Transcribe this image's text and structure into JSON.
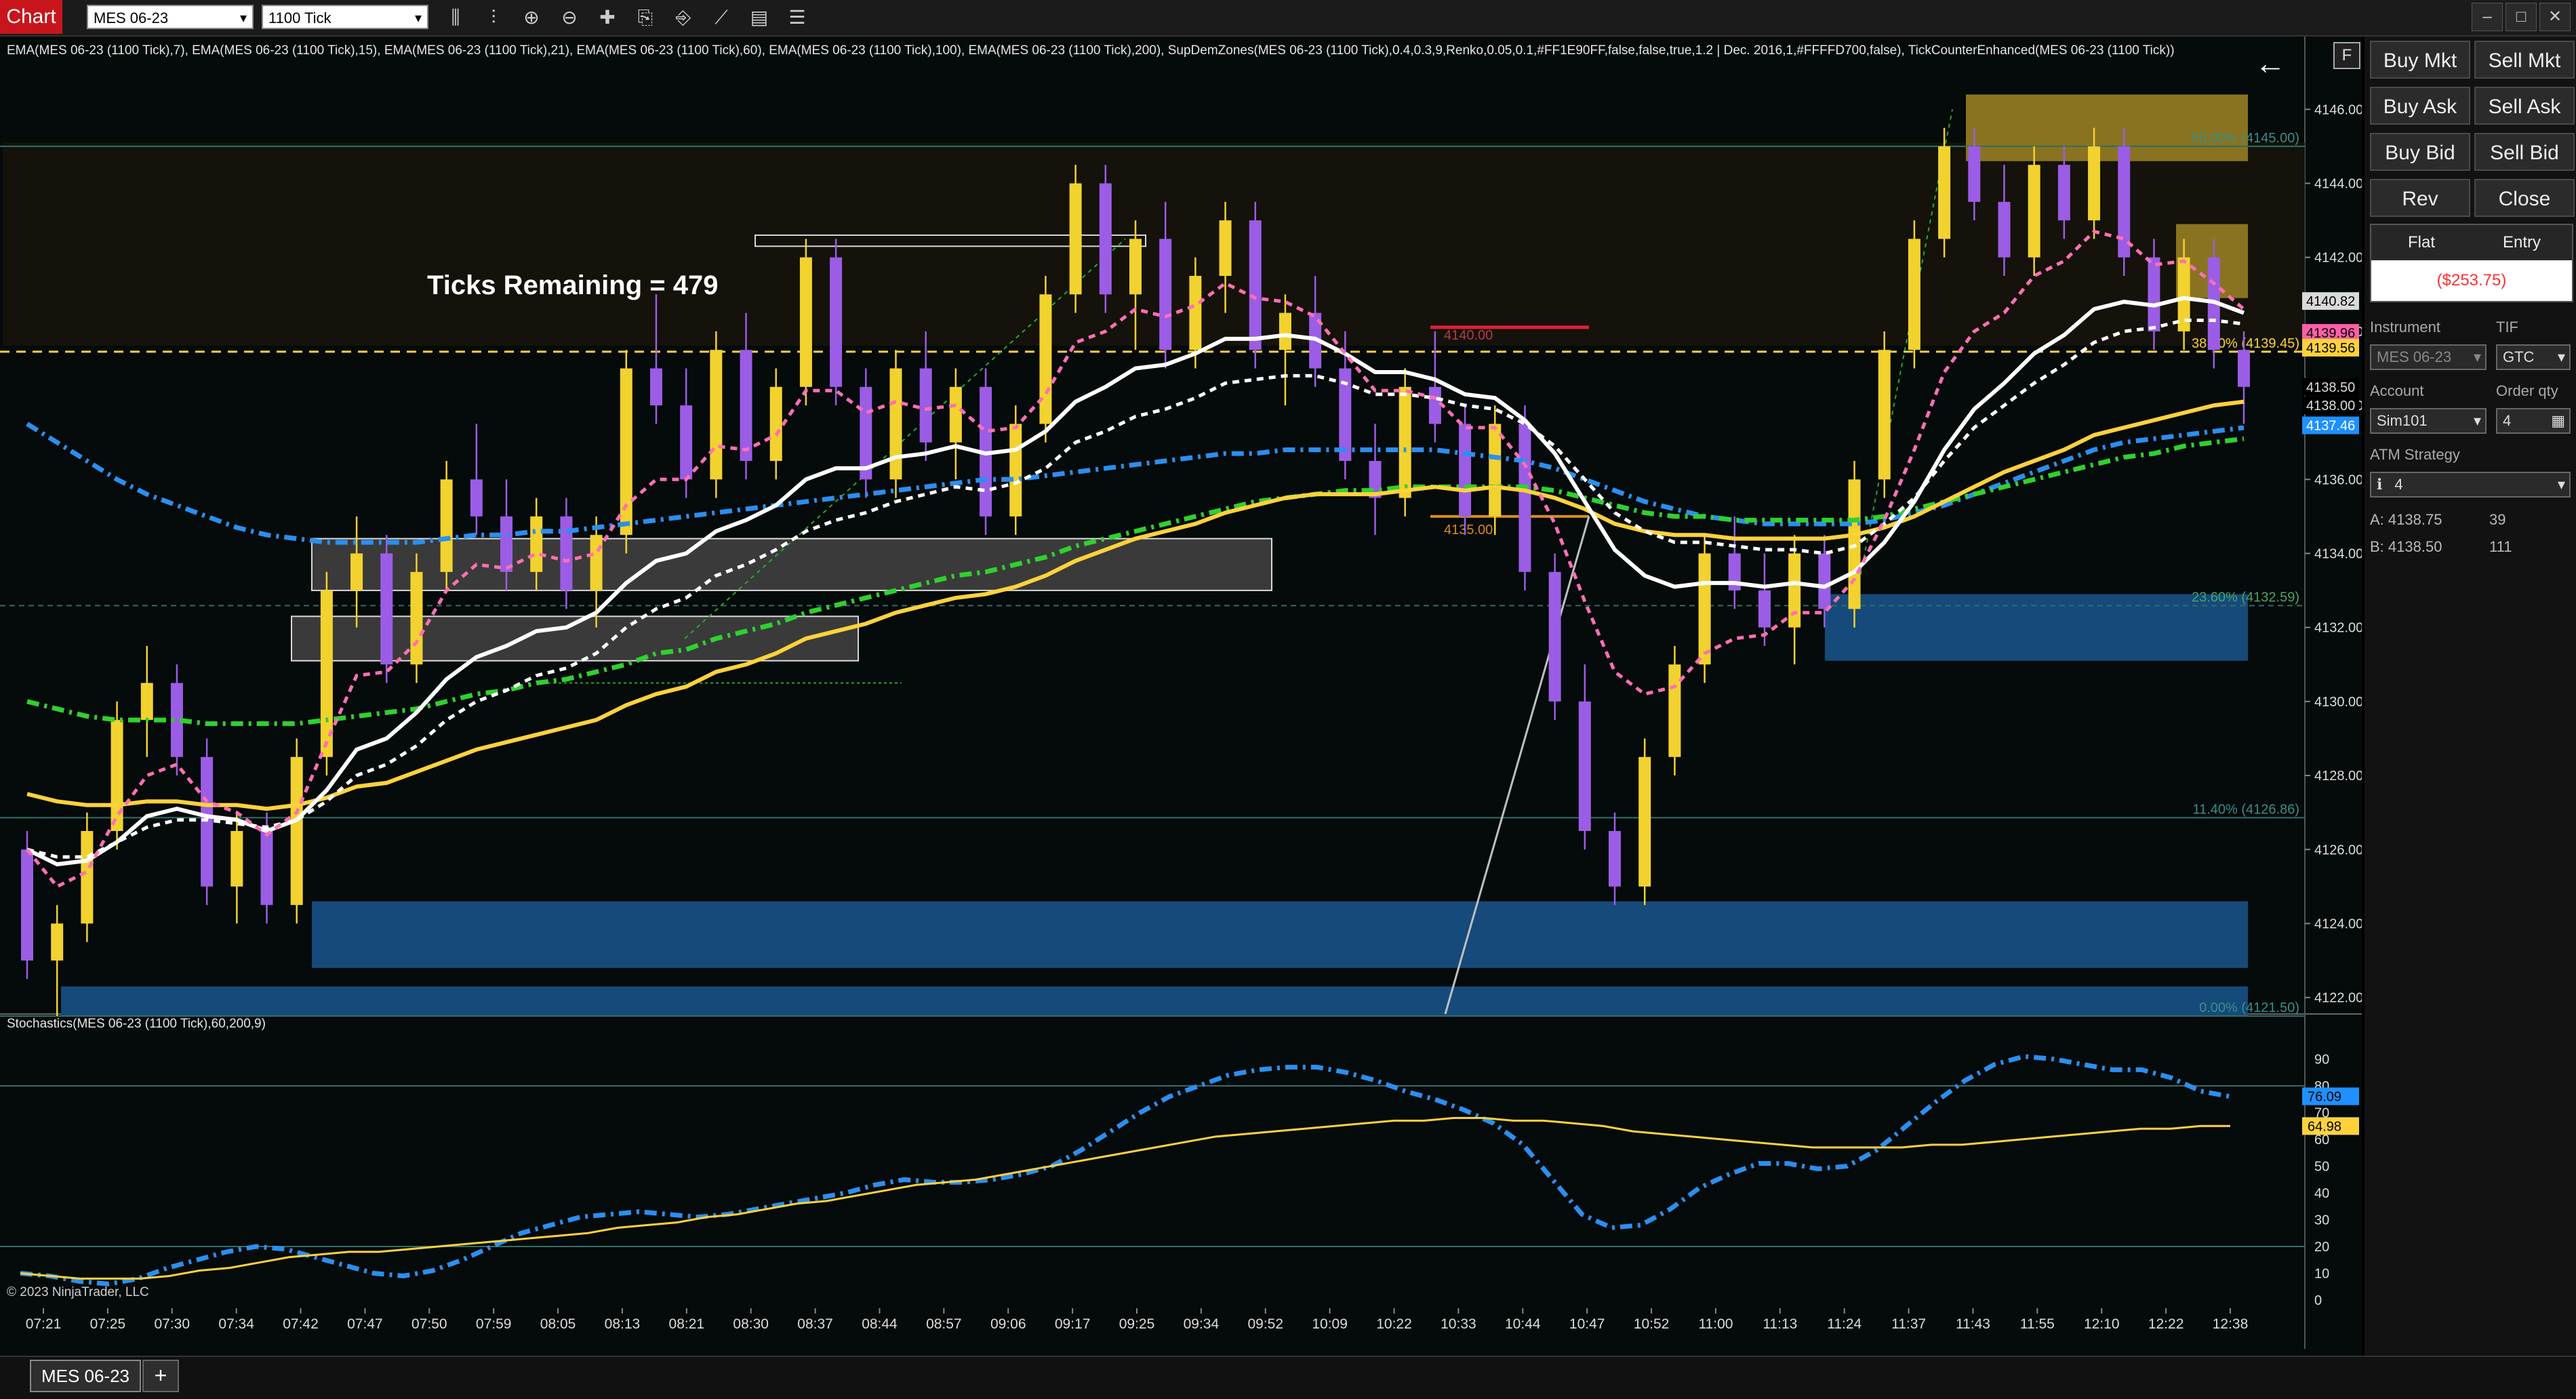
{
  "titlebar": {
    "chart_label": "Chart",
    "instrument": "MES 06-23",
    "interval": "1100 Tick",
    "tool_icons": [
      "bar-type-icon",
      "indicators-icon",
      "zoom-in-icon",
      "zoom-out-icon",
      "crosshair-icon",
      "properties-icon",
      "strategies-icon",
      "drawing-tools-icon",
      "data-box-icon",
      "list-icon"
    ]
  },
  "indicator_header": "EMA(MES 06-23 (1100 Tick),7), EMA(MES 06-23 (1100 Tick),15), EMA(MES 06-23 (1100 Tick),21), EMA(MES 06-23 (1100 Tick),60), EMA(MES 06-23 (1100 Tick),100), EMA(MES 06-23 (1100 Tick),200), SupDemZones(MES 06-23 (1100 Tick),0.4,0.3,9,Renko,0.05,0.1,#FF1E90FF,false,false,true,1.2 | Dec. 2016,1,#FFFFD700,false), TickCounterEnhanced(MES 06-23 (1100 Tick))",
  "ticks_remaining": "Ticks Remaining = 479",
  "fib_labels": [
    "50.00% (4145.00)",
    "38.20% (4139.45)",
    "23.60% (4132.59)",
    "11.40% (4126.86)",
    "0.00% (4121.50)"
  ],
  "drawn_labels": [
    "4140.00",
    "4135.00"
  ],
  "price_axis": [
    "4146.00",
    "4144.00",
    "4142.00",
    "4140.00",
    "4138.00",
    "4136.00",
    "4134.00",
    "4132.00",
    "4130.00",
    "4128.00",
    "4126.00",
    "4124.00",
    "4122.00"
  ],
  "price_tags": [
    {
      "text": "4140.82",
      "color": "#d9d9d9",
      "fg": "#000"
    },
    {
      "text": "4139.96",
      "color": "#ff5fa8",
      "fg": "#000"
    },
    {
      "text": "4139.56",
      "color": "#ffd23c",
      "fg": "#000"
    },
    {
      "text": "4138.50",
      "color": "#000",
      "fg": "#ddd"
    },
    {
      "text": "4138.00",
      "color": "#000",
      "fg": "#ddd"
    },
    {
      "text": "4137.46",
      "color": "#1e90ff",
      "fg": "#fff"
    }
  ],
  "stoch_header": "Stochastics(MES 06-23 (1100 Tick),60,200,9)",
  "stoch_axis": [
    "90",
    "80",
    "70",
    "60",
    "50",
    "40",
    "30",
    "20",
    "10",
    "0"
  ],
  "stoch_tags": [
    {
      "text": "76.09",
      "color": "#1e90ff"
    },
    {
      "text": "64.98",
      "color": "#ffd23c"
    }
  ],
  "time_axis": [
    "07:21",
    "07:25",
    "07:30",
    "07:34",
    "07:42",
    "07:47",
    "07:50",
    "07:59",
    "08:05",
    "08:13",
    "08:21",
    "08:30",
    "08:37",
    "08:44",
    "08:57",
    "09:06",
    "09:17",
    "09:25",
    "09:34",
    "09:52",
    "10:09",
    "10:22",
    "10:33",
    "10:44",
    "10:47",
    "10:52",
    "11:00",
    "11:13",
    "11:24",
    "11:37",
    "11:43",
    "11:55",
    "12:10",
    "12:22",
    "12:38"
  ],
  "copyright": "© 2023 NinjaTrader, LLC",
  "chart_data": {
    "type": "candlestick",
    "price_range": [
      4121.5,
      4146.5
    ],
    "last_price": 4138.5,
    "candles_ohlc": [
      [
        4126.0,
        4126.5,
        4122.5,
        4123.0
      ],
      [
        4123.0,
        4124.5,
        4121.5,
        4124.0
      ],
      [
        4124.0,
        4127.0,
        4123.5,
        4126.5
      ],
      [
        4126.5,
        4130.0,
        4126.0,
        4129.5
      ],
      [
        4129.5,
        4131.5,
        4128.5,
        4130.5
      ],
      [
        4130.5,
        4131.0,
        4128.0,
        4128.5
      ],
      [
        4128.5,
        4129.0,
        4124.5,
        4125.0
      ],
      [
        4125.0,
        4127.0,
        4124.0,
        4126.5
      ],
      [
        4126.5,
        4127.0,
        4124.0,
        4124.5
      ],
      [
        4124.5,
        4129.0,
        4124.0,
        4128.5
      ],
      [
        4128.5,
        4133.5,
        4128.0,
        4133.0
      ],
      [
        4133.0,
        4135.0,
        4132.0,
        4134.0
      ],
      [
        4134.0,
        4134.5,
        4130.5,
        4131.0
      ],
      [
        4131.0,
        4134.0,
        4130.5,
        4133.5
      ],
      [
        4133.5,
        4136.5,
        4133.0,
        4136.0
      ],
      [
        4136.0,
        4137.5,
        4134.5,
        4135.0
      ],
      [
        4135.0,
        4136.0,
        4133.0,
        4133.5
      ],
      [
        4133.5,
        4135.5,
        4133.0,
        4135.0
      ],
      [
        4135.0,
        4135.5,
        4132.5,
        4133.0
      ],
      [
        4133.0,
        4135.0,
        4132.0,
        4134.5
      ],
      [
        4134.5,
        4139.5,
        4134.0,
        4139.0
      ],
      [
        4139.0,
        4141.0,
        4137.5,
        4138.0
      ],
      [
        4138.0,
        4139.0,
        4135.5,
        4136.0
      ],
      [
        4136.0,
        4140.0,
        4135.5,
        4139.5
      ],
      [
        4139.5,
        4140.5,
        4136.0,
        4136.5
      ],
      [
        4136.5,
        4139.0,
        4136.0,
        4138.5
      ],
      [
        4138.5,
        4142.5,
        4138.0,
        4142.0
      ],
      [
        4142.0,
        4142.5,
        4138.0,
        4138.5
      ],
      [
        4138.5,
        4139.0,
        4135.5,
        4136.0
      ],
      [
        4136.0,
        4139.5,
        4135.5,
        4139.0
      ],
      [
        4139.0,
        4140.0,
        4136.5,
        4137.0
      ],
      [
        4137.0,
        4139.0,
        4136.0,
        4138.5
      ],
      [
        4138.5,
        4139.0,
        4134.5,
        4135.0
      ],
      [
        4135.0,
        4138.0,
        4134.5,
        4137.5
      ],
      [
        4137.5,
        4141.5,
        4137.0,
        4141.0
      ],
      [
        4141.0,
        4144.5,
        4140.5,
        4144.0
      ],
      [
        4144.0,
        4144.5,
        4140.5,
        4141.0
      ],
      [
        4141.0,
        4143.0,
        4139.5,
        4142.5
      ],
      [
        4142.5,
        4143.5,
        4139.0,
        4139.5
      ],
      [
        4139.5,
        4142.0,
        4139.0,
        4141.5
      ],
      [
        4141.5,
        4143.5,
        4140.5,
        4143.0
      ],
      [
        4143.0,
        4143.5,
        4139.0,
        4139.5
      ],
      [
        4139.5,
        4141.0,
        4138.0,
        4140.5
      ],
      [
        4140.5,
        4141.5,
        4138.5,
        4139.0
      ],
      [
        4139.0,
        4140.0,
        4136.0,
        4136.5
      ],
      [
        4136.5,
        4137.5,
        4134.5,
        4135.5
      ],
      [
        4135.5,
        4139.0,
        4135.0,
        4138.5
      ],
      [
        4138.5,
        4140.0,
        4137.0,
        4137.5
      ],
      [
        4137.5,
        4138.0,
        4134.5,
        4135.0
      ],
      [
        4135.0,
        4138.0,
        4134.5,
        4137.5
      ],
      [
        4137.5,
        4138.0,
        4133.0,
        4133.5
      ],
      [
        4133.5,
        4134.0,
        4129.5,
        4130.0
      ],
      [
        4130.0,
        4131.0,
        4126.0,
        4126.5
      ],
      [
        4126.5,
        4127.0,
        4124.5,
        4125.0
      ],
      [
        4125.0,
        4129.0,
        4124.5,
        4128.5
      ],
      [
        4128.5,
        4131.5,
        4128.0,
        4131.0
      ],
      [
        4131.0,
        4134.5,
        4130.5,
        4134.0
      ],
      [
        4134.0,
        4135.0,
        4132.5,
        4133.0
      ],
      [
        4133.0,
        4134.0,
        4131.5,
        4132.0
      ],
      [
        4132.0,
        4134.5,
        4131.0,
        4134.0
      ],
      [
        4134.0,
        4134.5,
        4132.0,
        4132.5
      ],
      [
        4132.5,
        4136.5,
        4132.0,
        4136.0
      ],
      [
        4136.0,
        4140.0,
        4135.5,
        4139.5
      ],
      [
        4139.5,
        4143.0,
        4139.0,
        4142.5
      ],
      [
        4142.5,
        4145.5,
        4142.0,
        4145.0
      ],
      [
        4145.0,
        4145.5,
        4143.0,
        4143.5
      ],
      [
        4143.5,
        4144.5,
        4141.5,
        4142.0
      ],
      [
        4142.0,
        4145.0,
        4141.5,
        4144.5
      ],
      [
        4144.5,
        4145.0,
        4142.5,
        4143.0
      ],
      [
        4143.0,
        4145.5,
        4142.5,
        4145.0
      ],
      [
        4145.0,
        4145.5,
        4141.5,
        4142.0
      ],
      [
        4142.0,
        4142.5,
        4139.5,
        4140.0
      ],
      [
        4140.0,
        4142.5,
        4139.5,
        4142.0
      ],
      [
        4142.0,
        4142.5,
        4139.0,
        4139.5
      ],
      [
        4139.5,
        4140.0,
        4137.5,
        4138.5
      ]
    ],
    "ema_7": [
      4126,
      4125,
      4125.4,
      4126.9,
      4128,
      4128.3,
      4127.3,
      4127,
      4126.4,
      4127,
      4128.9,
      4130.7,
      4130.8,
      4131.6,
      4133,
      4133.7,
      4133.6,
      4134,
      4133.8,
      4134,
      4135.3,
      4136,
      4136,
      4136.9,
      4136.8,
      4137.2,
      4138.4,
      4138.4,
      4137.8,
      4138.1,
      4137.9,
      4138,
      4137.3,
      4137.4,
      4138.3,
      4139.7,
      4140,
      4140.6,
      4140.4,
      4140.7,
      4141.3,
      4140.9,
      4140.8,
      4140.4,
      4139.4,
      4138.4,
      4138.4,
      4138.2,
      4137.4,
      4137.4,
      4136.4,
      4134.8,
      4132.7,
      4130.8,
      4130.2,
      4130.4,
      4131.3,
      4131.7,
      4131.8,
      4132.4,
      4132.4,
      4133.3,
      4134.9,
      4136.8,
      4138.9,
      4140,
      4140.5,
      4141.5,
      4141.9,
      4142.7,
      4142.5,
      4141.8,
      4141.9,
      4141.3,
      4140.6
    ],
    "ema_15": [
      4126,
      4125.6,
      4125.7,
      4126.2,
      4126.9,
      4127.1,
      4126.9,
      4126.8,
      4126.5,
      4126.8,
      4127.6,
      4128.7,
      4129,
      4129.7,
      4130.6,
      4131.2,
      4131.5,
      4131.9,
      4132,
      4132.4,
      4133.2,
      4133.8,
      4134,
      4134.6,
      4134.9,
      4135.3,
      4136,
      4136.3,
      4136.3,
      4136.6,
      4136.7,
      4136.9,
      4136.7,
      4136.8,
      4137.3,
      4138.1,
      4138.5,
      4139,
      4139.1,
      4139.4,
      4139.8,
      4139.8,
      4139.9,
      4139.8,
      4139.4,
      4138.9,
      4138.9,
      4138.7,
      4138.3,
      4138.2,
      4137.6,
      4136.7,
      4135.4,
      4134.1,
      4133.4,
      4133.1,
      4133.2,
      4133.2,
      4133.1,
      4133.2,
      4133.1,
      4133.5,
      4134.3,
      4135.4,
      4136.8,
      4137.9,
      4138.6,
      4139.4,
      4139.9,
      4140.6,
      4140.8,
      4140.7,
      4140.9,
      4140.8,
      4140.5
    ],
    "ema_21": [
      4126,
      4125.8,
      4125.8,
      4126.2,
      4126.6,
      4126.8,
      4126.8,
      4126.7,
      4126.6,
      4126.8,
      4127.3,
      4128,
      4128.3,
      4128.8,
      4129.5,
      4130,
      4130.3,
      4130.7,
      4130.9,
      4131.3,
      4132,
      4132.5,
      4132.8,
      4133.4,
      4133.7,
      4134.1,
      4134.6,
      4134.9,
      4135.1,
      4135.4,
      4135.6,
      4135.8,
      4135.7,
      4135.9,
      4136.3,
      4137,
      4137.3,
      4137.7,
      4137.9,
      4138.2,
      4138.6,
      4138.7,
      4138.8,
      4138.8,
      4138.6,
      4138.3,
      4138.3,
      4138.2,
      4138,
      4137.9,
      4137.5,
      4136.9,
      4136,
      4135.1,
      4134.6,
      4134.3,
      4134.3,
      4134.2,
      4134.1,
      4134.1,
      4134,
      4134.2,
      4134.8,
      4135.5,
      4136.5,
      4137.4,
      4138,
      4138.6,
      4139.1,
      4139.7,
      4140,
      4140.1,
      4140.3,
      4140.3,
      4140.2
    ],
    "ema_60": [
      4127.5,
      4127.3,
      4127.2,
      4127.2,
      4127.3,
      4127.3,
      4127.2,
      4127.2,
      4127.1,
      4127.2,
      4127.4,
      4127.7,
      4127.8,
      4128.1,
      4128.4,
      4128.7,
      4128.9,
      4129.1,
      4129.3,
      4129.5,
      4129.9,
      4130.2,
      4130.4,
      4130.8,
      4131,
      4131.3,
      4131.7,
      4131.9,
      4132.1,
      4132.4,
      4132.6,
      4132.8,
      4132.9,
      4133.1,
      4133.4,
      4133.8,
      4134.1,
      4134.4,
      4134.6,
      4134.8,
      4135.1,
      4135.3,
      4135.5,
      4135.6,
      4135.6,
      4135.6,
      4135.7,
      4135.8,
      4135.7,
      4135.8,
      4135.7,
      4135.5,
      4135.2,
      4134.8,
      4134.6,
      4134.5,
      4134.5,
      4134.4,
      4134.4,
      4134.4,
      4134.4,
      4134.5,
      4134.7,
      4135,
      4135.4,
      4135.8,
      4136.2,
      4136.5,
      4136.8,
      4137.2,
      4137.4,
      4137.6,
      4137.8,
      4138,
      4138.1
    ],
    "ema_100": [
      4130,
      4129.8,
      4129.6,
      4129.5,
      4129.5,
      4129.5,
      4129.4,
      4129.4,
      4129.4,
      4129.4,
      4129.5,
      4129.6,
      4129.7,
      4129.8,
      4130,
      4130.2,
      4130.3,
      4130.5,
      4130.6,
      4130.8,
      4131,
      4131.3,
      4131.4,
      4131.7,
      4131.9,
      4132.1,
      4132.4,
      4132.6,
      4132.8,
      4133,
      4133.2,
      4133.4,
      4133.5,
      4133.7,
      4133.9,
      4134.2,
      4134.4,
      4134.6,
      4134.8,
      4135,
      4135.2,
      4135.4,
      4135.5,
      4135.6,
      4135.7,
      4135.7,
      4135.8,
      4135.8,
      4135.8,
      4135.8,
      4135.8,
      4135.7,
      4135.5,
      4135.3,
      4135.1,
      4135,
      4135,
      4134.9,
      4134.9,
      4134.9,
      4134.9,
      4134.9,
      4135,
      4135.2,
      4135.4,
      4135.6,
      4135.8,
      4136,
      4136.2,
      4136.4,
      4136.6,
      4136.7,
      4136.9,
      4137,
      4137.1
    ],
    "ema_200": [
      4137.5,
      4137,
      4136.5,
      4136,
      4135.6,
      4135.3,
      4135,
      4134.7,
      4134.5,
      4134.4,
      4134.3,
      4134.3,
      4134.3,
      4134.3,
      4134.4,
      4134.5,
      4134.5,
      4134.6,
      4134.6,
      4134.7,
      4134.8,
      4134.9,
      4135,
      4135.1,
      4135.2,
      4135.3,
      4135.4,
      4135.5,
      4135.6,
      4135.7,
      4135.8,
      4135.9,
      4136,
      4136,
      4136.1,
      4136.2,
      4136.3,
      4136.4,
      4136.5,
      4136.6,
      4136.7,
      4136.7,
      4136.8,
      4136.8,
      4136.8,
      4136.8,
      4136.8,
      4136.8,
      4136.7,
      4136.6,
      4136.5,
      4136.3,
      4136,
      4135.7,
      4135.4,
      4135.2,
      4135,
      4134.9,
      4134.8,
      4134.8,
      4134.8,
      4134.8,
      4134.9,
      4135.1,
      4135.3,
      4135.6,
      4135.9,
      4136.2,
      4136.5,
      4136.8,
      4137,
      4137.1,
      4137.2,
      4137.3,
      4137.4
    ],
    "stoch_k": [
      10,
      9,
      7,
      6,
      8,
      12,
      15,
      18,
      20,
      19,
      16,
      13,
      10,
      9,
      11,
      15,
      20,
      25,
      28,
      31,
      32,
      33,
      32,
      31,
      32,
      34,
      36,
      38,
      40,
      43,
      45,
      44,
      44,
      45,
      47,
      50,
      56,
      63,
      70,
      76,
      80,
      84,
      86,
      87,
      87,
      85,
      82,
      78,
      75,
      71,
      66,
      58,
      45,
      32,
      27,
      28,
      34,
      42,
      47,
      51,
      51,
      49,
      50,
      56,
      65,
      74,
      82,
      88,
      91,
      90,
      88,
      86,
      86,
      83,
      78,
      76
    ],
    "stoch_d": [
      10,
      9,
      8,
      8,
      8,
      9,
      11,
      12,
      14,
      16,
      17,
      18,
      18,
      19,
      20,
      21,
      22,
      23,
      24,
      25,
      27,
      28,
      29,
      31,
      32,
      34,
      36,
      37,
      39,
      41,
      43,
      44,
      45,
      47,
      49,
      51,
      53,
      55,
      57,
      59,
      61,
      62,
      63,
      64,
      65,
      66,
      67,
      67,
      68,
      68,
      67,
      67,
      66,
      65,
      63,
      62,
      61,
      60,
      59,
      58,
      57,
      57,
      57,
      57,
      58,
      58,
      59,
      60,
      61,
      62,
      63,
      64,
      64,
      65,
      65
    ]
  },
  "right_panel": {
    "buttons": [
      [
        "Buy Mkt",
        "Sell Mkt"
      ],
      [
        "Buy Ask",
        "Sell Ask"
      ],
      [
        "Buy Bid",
        "Sell Bid"
      ],
      [
        "Rev",
        "Close"
      ]
    ],
    "position_label": "Flat",
    "entry_label": "Entry",
    "pnl": "($253.75)",
    "instrument_label": "Instrument",
    "instrument_value": "MES 06-23",
    "tif_label": "TIF",
    "tif_value": "GTC",
    "account_label": "Account",
    "account_value": "Sim101",
    "order_qty_label": "Order qty",
    "order_qty_value": "4",
    "atm_label": "ATM Strategy",
    "atm_value": "4",
    "ask_line": "A:  4138.75",
    "ask_size": "39",
    "bid_line": "B:  4138.50",
    "bid_size": "111"
  },
  "bottom_tab": "MES 06-23",
  "colors": {
    "bull_candle": "#f2d22e",
    "bear_candle": "#9b5de5",
    "ema_7": "#ff6fb4",
    "ema_15": "#ffffff",
    "ema_21": "#ffffff",
    "ema_60": "#ffd23c",
    "ema_100": "#2fd12f",
    "ema_200": "#2b8ff0",
    "pnl_red": "#ff3030",
    "accent_red": "#c8151b"
  }
}
